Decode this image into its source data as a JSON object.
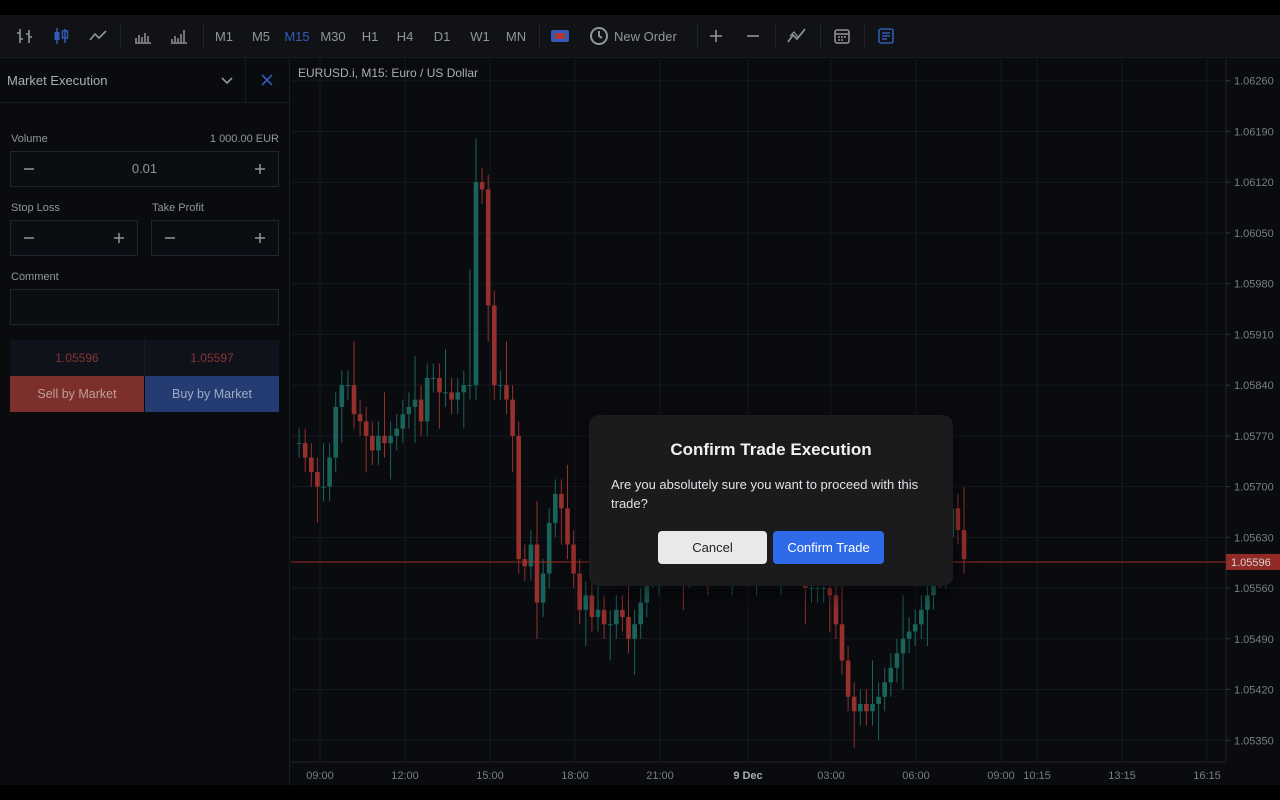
{
  "toolbar": {
    "timeframes": [
      "M1",
      "M5",
      "M15",
      "M30",
      "H1",
      "H4",
      "D1",
      "W1",
      "MN"
    ],
    "active_timeframe": "M15",
    "new_order_label": "New Order",
    "icons": [
      "bar-chart-icon",
      "candlestick-chart-icon",
      "line-chart-icon",
      "volume-icon",
      "histogram-icon",
      "chart-type-icon",
      "clock-icon",
      "zoom-in-icon",
      "zoom-out-icon",
      "indicators-icon",
      "calendar-icon",
      "notes-icon"
    ]
  },
  "panel": {
    "title": "Market Execution",
    "volume_label": "Volume",
    "volume_value": "0.01",
    "volume_amount": "1 000.00 EUR",
    "stop_loss_label": "Stop Loss",
    "take_profit_label": "Take Profit",
    "comment_label": "Comment",
    "bid_price": "1.05596",
    "ask_price": "1.05597",
    "sell_label": "Sell by Market",
    "buy_label": "Buy by Market"
  },
  "chart_data": {
    "type": "candlestick",
    "title": "EURUSD.i, M15: Euro / US Dollar",
    "x_ticks": [
      "09:00",
      "12:00",
      "15:00",
      "18:00",
      "21:00",
      "9 Dec",
      "03:00",
      "06:00",
      "09:00",
      "10:15",
      "13:15",
      "16:15"
    ],
    "y_ticks": [
      "1.06260",
      "1.06190",
      "1.06120",
      "1.06050",
      "1.05980",
      "1.05910",
      "1.05840",
      "1.05770",
      "1.05700",
      "1.05630",
      "1.05560",
      "1.05490",
      "1.05420",
      "1.05350"
    ],
    "ylim": [
      1.0532,
      1.0629
    ],
    "current_price": "1.05596",
    "grid": true,
    "colors": {
      "up": "#26a69a",
      "down": "#ef5350",
      "price_line": "#c0392b"
    }
  },
  "dialog": {
    "title": "Confirm Trade Execution",
    "message": "Are you absolutely sure you want to proceed with this trade?",
    "cancel_label": "Cancel",
    "confirm_label": "Confirm Trade"
  }
}
